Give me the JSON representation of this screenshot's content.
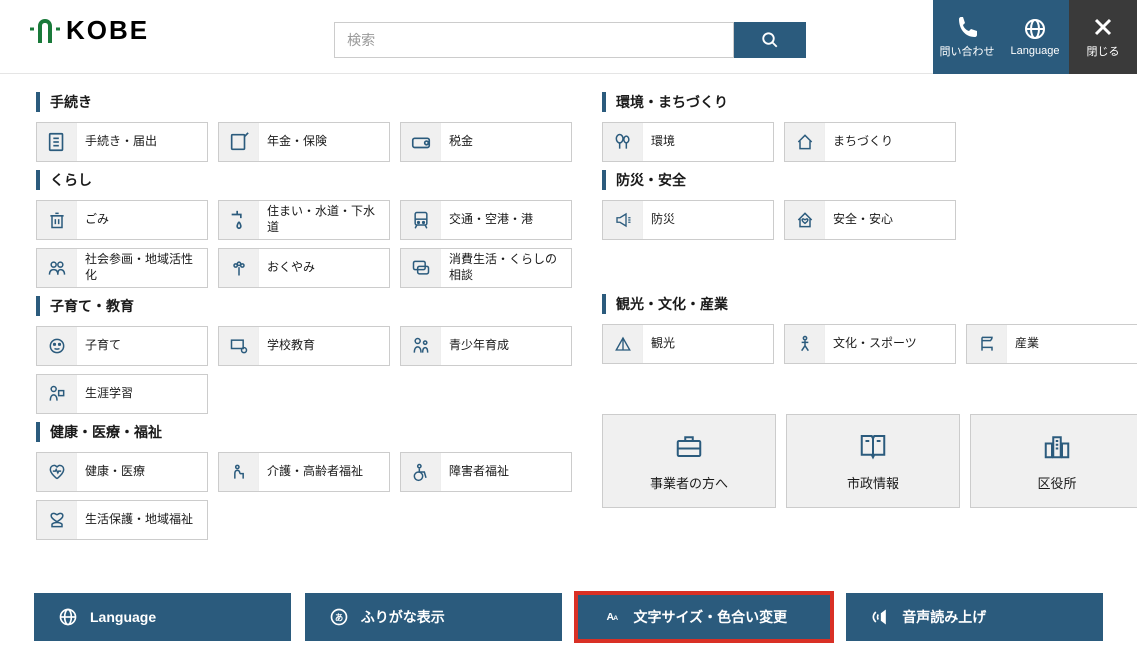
{
  "header": {
    "logo": "KOBE",
    "search_placeholder": "検索",
    "contact": "問い合わせ",
    "language": "Language",
    "close": "閉じる"
  },
  "left": {
    "s1": {
      "title": "手続き",
      "items": [
        "手続き・届出",
        "年金・保険",
        "税金"
      ]
    },
    "s2": {
      "title": "くらし",
      "items": [
        "ごみ",
        "住まい・水道・下水道",
        "交通・空港・港",
        "社会参画・地域活性化",
        "おくやみ",
        "消費生活・くらしの相談"
      ]
    },
    "s3": {
      "title": "子育て・教育",
      "items": [
        "子育て",
        "学校教育",
        "青少年育成",
        "生涯学習"
      ]
    },
    "s4": {
      "title": "健康・医療・福祉",
      "items": [
        "健康・医療",
        "介護・高齢者福祉",
        "障害者福祉",
        "生活保護・地域福祉"
      ]
    }
  },
  "right": {
    "s1": {
      "title": "環境・まちづくり",
      "items": [
        "環境",
        "まちづくり"
      ]
    },
    "s2": {
      "title": "防災・安全",
      "items": [
        "防災",
        "安全・安心"
      ]
    },
    "s3": {
      "title": "観光・文化・産業",
      "items": [
        "観光",
        "文化・スポーツ",
        "産業"
      ]
    },
    "big": [
      "事業者の方へ",
      "市政情報",
      "区役所"
    ]
  },
  "footer": {
    "language": "Language",
    "furigana": "ふりがな表示",
    "textsize": "文字サイズ・色合い変更",
    "voice": "音声読み上げ"
  }
}
